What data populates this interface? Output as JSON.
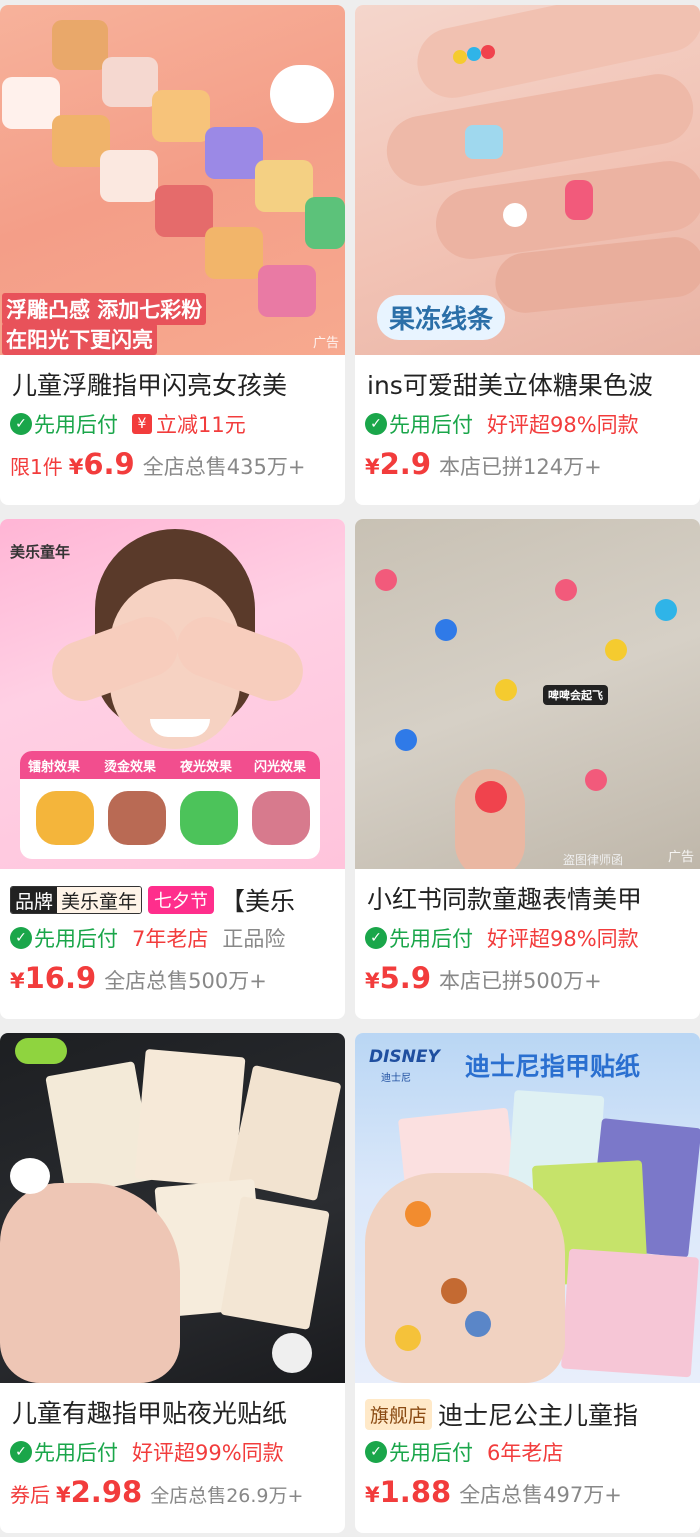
{
  "products": [
    {
      "image_text": {
        "line1": "浮雕凸感 添加七彩粉",
        "line2": "在阳光下更闪亮",
        "ad": "广告"
      },
      "title": "儿童浮雕指甲闪亮女孩美",
      "tag_pay": "先用后付",
      "tag_promo": "立减11元",
      "price_prefix": "限1件",
      "currency": "¥",
      "price": "6.9",
      "sold": "全店总售435万+"
    },
    {
      "image_text": {
        "label": "果冻线条"
      },
      "title": "ins可爱甜美立体糖果色波",
      "tag_pay": "先用后付",
      "tag_promo": "好评超98%同款",
      "currency": "¥",
      "price": "2.9",
      "sold": "本店已拼124万+"
    },
    {
      "image_text": {
        "brand": "美乐童年",
        "e1": "镭射效果",
        "e2": "烫金效果",
        "e3": "夜光效果",
        "e4": "闪光效果"
      },
      "badge_key": "品牌",
      "badge_value": "美乐童年",
      "festival": "七夕节",
      "title": "【美乐",
      "tag_pay": "先用后付",
      "tag_a": "7年老店",
      "tag_b": "正品险",
      "currency": "¥",
      "price": "16.9",
      "sold": "全店总售500万+"
    },
    {
      "image_text": {
        "bubble": "啤啤会起飞",
        "watermark": "盗图律师函",
        "ad": "广告"
      },
      "title": "小红书同款童趣表情美甲",
      "tag_pay": "先用后付",
      "tag_promo": "好评超98%同款",
      "currency": "¥",
      "price": "5.9",
      "sold": "本店已拼500万+"
    },
    {
      "title": "儿童有趣指甲贴夜光贴纸",
      "tag_pay": "先用后付",
      "tag_promo": "好评超99%同款",
      "price_prefix": "券后",
      "currency": "¥",
      "price": "2.98",
      "sold": "全店总售26.9万+"
    },
    {
      "image_text": {
        "logo": "DISNEY",
        "logo_sub": "迪士尼",
        "headline": "迪士尼指甲贴纸"
      },
      "shop_badge": "旗舰店",
      "title": "迪士尼公主儿童指",
      "tag_pay": "先用后付",
      "tag_a": "6年老店",
      "currency": "¥",
      "price": "1.88",
      "sold": "全店总售497万+"
    }
  ],
  "icons": {
    "pay": "leaf-check-icon",
    "promo": "yen-coupon-icon"
  },
  "colors": {
    "price_red": "#f23c3c",
    "pay_green": "#1aa64a",
    "festival_pink": "#ff2e8c"
  }
}
